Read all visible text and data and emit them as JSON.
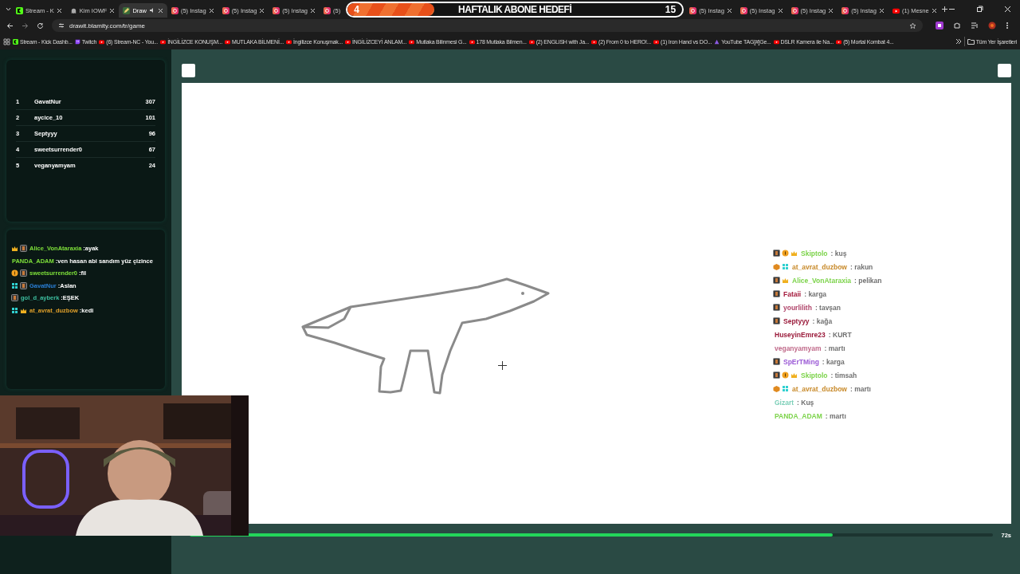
{
  "tab_strip": [
    {
      "kind": "tab",
      "title": "Stream - K",
      "selected": false
    },
    {
      "kind": "tab",
      "title": "Kim IOWF",
      "selected": false
    },
    {
      "kind": "tab",
      "title": "Draw",
      "selected": true
    },
    {
      "kind": "tab",
      "title": "(5) Instag",
      "selected": false
    },
    {
      "kind": "tab",
      "title": "(5) Instag",
      "selected": false
    },
    {
      "kind": "tab",
      "title": "(5) Instag",
      "selected": false
    },
    {
      "kind": "stub",
      "title": "(5)",
      "selected": false
    },
    {
      "kind": "goal",
      "count": "4",
      "title": "HAFTALIK ABONE HEDEFİ",
      "target": "15",
      "level": 0.26
    },
    {
      "kind": "tab",
      "title": "(5) Instag",
      "selected": false
    },
    {
      "kind": "tab",
      "title": "(5) Instag",
      "selected": false
    },
    {
      "kind": "tab",
      "title": "(5) Instag",
      "selected": false
    },
    {
      "kind": "tab",
      "title": "(5) Instag",
      "selected": false
    },
    {
      "kind": "tab",
      "title": "(1) Mesne",
      "selected": false
    }
  ],
  "address": {
    "url": "drawit.blamity.com/tr/game"
  },
  "bookmarks": [
    "Stream - Kick Dashb...",
    "Twitch",
    "(6) Stream-NC - You...",
    "İNGİLİZCE KONUŞM...",
    "MUTLAKA BİLMENİ...",
    "İngilizce Konuşmak...",
    "İNGİLİZCEYİ ANLAM...",
    "Mutlaka Bilinmesi G...",
    "178 Mutlaka Bilmen...",
    "(2) ENGLISH with Ja...",
    "(2) From 0 to HERO!...",
    "(1) Iron Hand vs DO...",
    "YouTube TAG[#]Ge...",
    "DSLR Kamera ile Na...",
    "(5) Mortal Kombat 4..."
  ],
  "all_bookmarks": "Tüm Yer İşaretleri",
  "leaderboard": [
    {
      "rank": "1",
      "name": "GavatNur",
      "score": "307"
    },
    {
      "rank": "2",
      "name": "aycice_10",
      "score": "101"
    },
    {
      "rank": "3",
      "name": "Septyyy",
      "score": "96"
    },
    {
      "rank": "4",
      "name": "sweetsurrender0",
      "score": "67"
    },
    {
      "rank": "5",
      "name": "veganyamyam",
      "score": "24"
    }
  ],
  "chat": [
    {
      "name": "Alice_VonAtaraxia",
      "color": "#7ee03a",
      "text": ":ayak"
    },
    {
      "name": "PANDA_ADAM",
      "color": "#7ee03a",
      "text": ":ven hasan abi sandım yüz çizince"
    },
    {
      "name": "sweetsurrender0",
      "color": "#7ee03a",
      "text": ":fil"
    },
    {
      "name": "GavatNur",
      "color": "#2a7fd6",
      "text": ":Aslan"
    },
    {
      "name": "gol_d_ayberk",
      "color": "#3dbfa0",
      "text": ":EŞEK"
    },
    {
      "name": "at_avrat_duzbow",
      "color": "#e0a02a",
      "text": ":kedi"
    }
  ],
  "game": {
    "progress": {
      "level": 0.8,
      "time_left": "72s"
    },
    "guesses": [
      {
        "name": "Skiptolo",
        "color": "#7cd34a",
        "text": ": kuş"
      },
      {
        "name": "at_avrat_duzbow",
        "color": "#c88a2a",
        "text": ": rakun"
      },
      {
        "name": "Alice_VonAtaraxia",
        "color": "#7cd34a",
        "text": ": pelikan"
      },
      {
        "name": "Fataii",
        "color": "#a3173a",
        "text": ": karga"
      },
      {
        "name": "yourlilith",
        "color": "#b0456a",
        "text": ": tavşan"
      },
      {
        "name": "Septyyy",
        "color": "#9a1a3a",
        "text": ": kağa"
      },
      {
        "name": "HuseyinEmre23",
        "color": "#9a1a3a",
        "text": ": KURT"
      },
      {
        "name": "veganyamyam",
        "color": "#c06a8a",
        "text": ": martı"
      },
      {
        "name": "SpErTMing",
        "color": "#9b5ad6",
        "text": ": karga"
      },
      {
        "name": "Skiptolo",
        "color": "#7cd34a",
        "text": ": timsah"
      },
      {
        "name": "at_avrat_duzbow",
        "color": "#c88a2a",
        "text": ": martı"
      },
      {
        "name": "Gizart",
        "color": "#7ccfb8",
        "text": ": Kuş"
      },
      {
        "name": "PANDA_ADAM",
        "color": "#7cd34a",
        "text": ": martı"
      }
    ]
  }
}
